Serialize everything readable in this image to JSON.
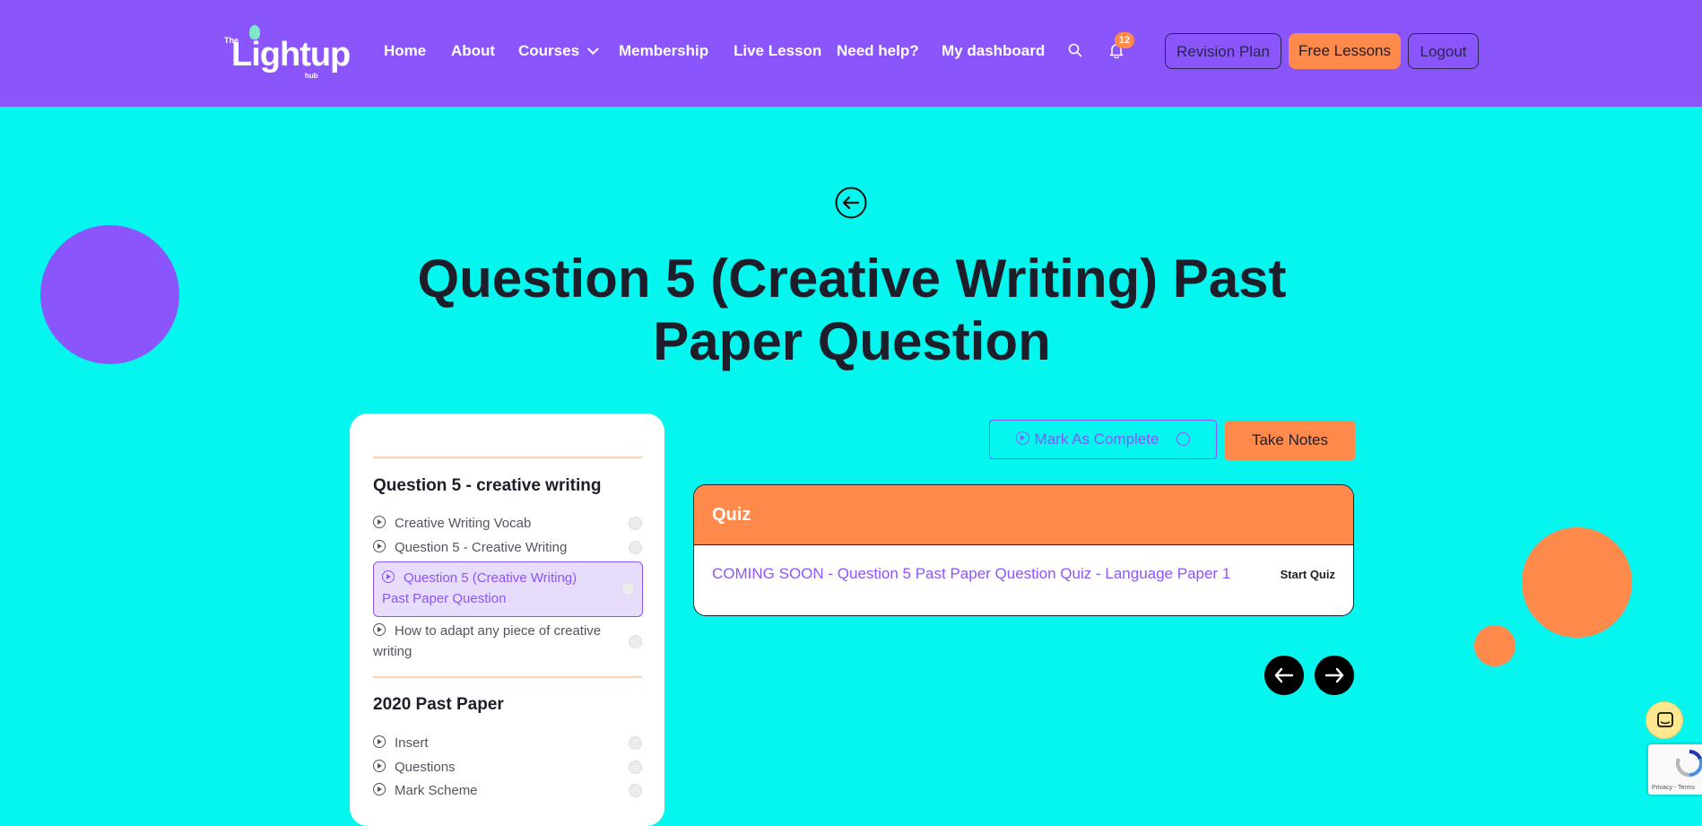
{
  "header": {
    "logo": {
      "top": "The",
      "main": "Lightup",
      "bottom": "hub"
    },
    "nav": [
      {
        "label": "Home"
      },
      {
        "label": "About"
      },
      {
        "label": "Courses"
      },
      {
        "label": "Membership"
      },
      {
        "label": "Live Lesson"
      },
      {
        "label": "Need help?"
      },
      {
        "label": "My dashboard"
      }
    ],
    "notification_count": "12",
    "buttons": {
      "revision_plan": "Revision Plan",
      "free_lessons": "Free Lessons",
      "logout": "Logout"
    }
  },
  "page": {
    "title": "Question 5 (Creative Writing) Past Paper Question"
  },
  "sidebar": {
    "sections": [
      {
        "title": "Question 5 - creative writing",
        "lessons": [
          {
            "label": "Creative Writing Vocab"
          },
          {
            "label": "Question 5 - Creative Writing"
          },
          {
            "label": "Question 5 (Creative Writing) Past Paper Question"
          },
          {
            "label": "How to adapt any piece of creative writing"
          }
        ]
      },
      {
        "title": "2020 Past Paper",
        "lessons": [
          {
            "label": "Insert"
          },
          {
            "label": "Questions"
          },
          {
            "label": "Mark Scheme"
          }
        ]
      }
    ]
  },
  "actions": {
    "mark_complete": "Mark As Complete",
    "take_notes": "Take Notes"
  },
  "quiz": {
    "heading": "Quiz",
    "item_title": "COMING SOON - Question 5 Past Paper Question Quiz - Language Paper 1",
    "start_label": "Start Quiz"
  },
  "recaptcha": {
    "text": "Privacy - Terms"
  },
  "colors": {
    "header": "#8b55fc",
    "background": "#05f6ee",
    "accent": "#ff8a4c",
    "purple": "#8b55fc"
  }
}
